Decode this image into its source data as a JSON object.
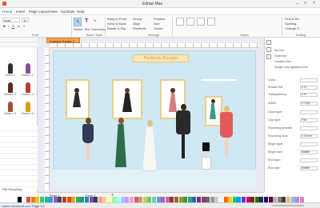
{
  "app": {
    "title": "Edraw Max"
  },
  "menu": [
    "Home",
    "Insert",
    "Page Layout",
    "View",
    "Symbols",
    "Help"
  ],
  "ribbon": {
    "font_name": "Arial",
    "font_size": "10",
    "select_label": "Select",
    "text_label": "Text",
    "connector_label": "Connector",
    "arrange": [
      "Bring to Front",
      "Send to Back",
      "Rotate & Flip",
      "Group",
      "Align",
      "Distribute",
      "Position",
      "Size",
      "Center"
    ],
    "groups": [
      "Font",
      "Basic Tools",
      "Arrange",
      "Styles",
      "Editing"
    ],
    "editing": [
      "Find & Re...",
      "Spelling...",
      "Change S..."
    ]
  },
  "library": {
    "items": [
      "Dress 1",
      "Dress 1-2",
      "Dress 1-3",
      "Dress 1-4",
      "Dress 1-5",
      "Dress 1-6"
    ],
    "footer": "File Recovery"
  },
  "document": {
    "tab": "Fashion Design 2",
    "title": "Fashion Design"
  },
  "properties": {
    "line_options": [
      "No line",
      "Solid line",
      "Gradient line",
      "Single color gradient line"
    ],
    "rows": [
      "Color:",
      "Shade/Tint:",
      "Transparency:",
      "Width:",
      "Dash type:",
      "Cap type:",
      "Rounding presets:",
      "Rounding size:",
      "Begin type:",
      "Begin size:",
      "End type:",
      "End size:"
    ],
    "values": [
      "",
      "0 %",
      "0 %",
      "0.75 pt",
      "",
      "Flat",
      "",
      "0.00 mm",
      "",
      "Middle",
      "",
      "Middle"
    ]
  },
  "pagetabs": {
    "page": "Page-1",
    "current": "Page-1"
  },
  "status": {
    "left": "www.edrawsoft.com",
    "page": "Page 1/1"
  },
  "palette": [
    "#000000",
    "#ffffff",
    "#e74c3c",
    "#e67e22",
    "#f1c40f",
    "#2ecc71",
    "#1abc9c",
    "#3498db",
    "#9b59b6",
    "#34495e",
    "#c0392b",
    "#d35400",
    "#f39c12",
    "#27ae60",
    "#16a085",
    "#2980b9",
    "#8e44ad",
    "#2c3e50",
    "#ff9999",
    "#ffcc99",
    "#ffff99",
    "#99ff99",
    "#99ffff",
    "#99ccff",
    "#cc99ff",
    "#ff99cc",
    "#cc6666",
    "#cc9966",
    "#cccc66",
    "#66cc66",
    "#66cccc",
    "#6699cc",
    "#9966cc",
    "#cc6699",
    "#993333",
    "#996633",
    "#999933",
    "#339933",
    "#339999",
    "#336699",
    "#663399",
    "#993366",
    "#666666",
    "#999999",
    "#cccccc",
    "#f5f5f5",
    "#ff6600",
    "#ffcc00",
    "#00cc66",
    "#0099ff",
    "#6633cc",
    "#cc0066",
    "#663300",
    "#336600",
    "#003366",
    "#330066",
    "#660033",
    "#b0b0b0",
    "#808080",
    "#404040",
    "#e0c080",
    "#80c0e0",
    "#c080e0",
    "#e080c0"
  ]
}
